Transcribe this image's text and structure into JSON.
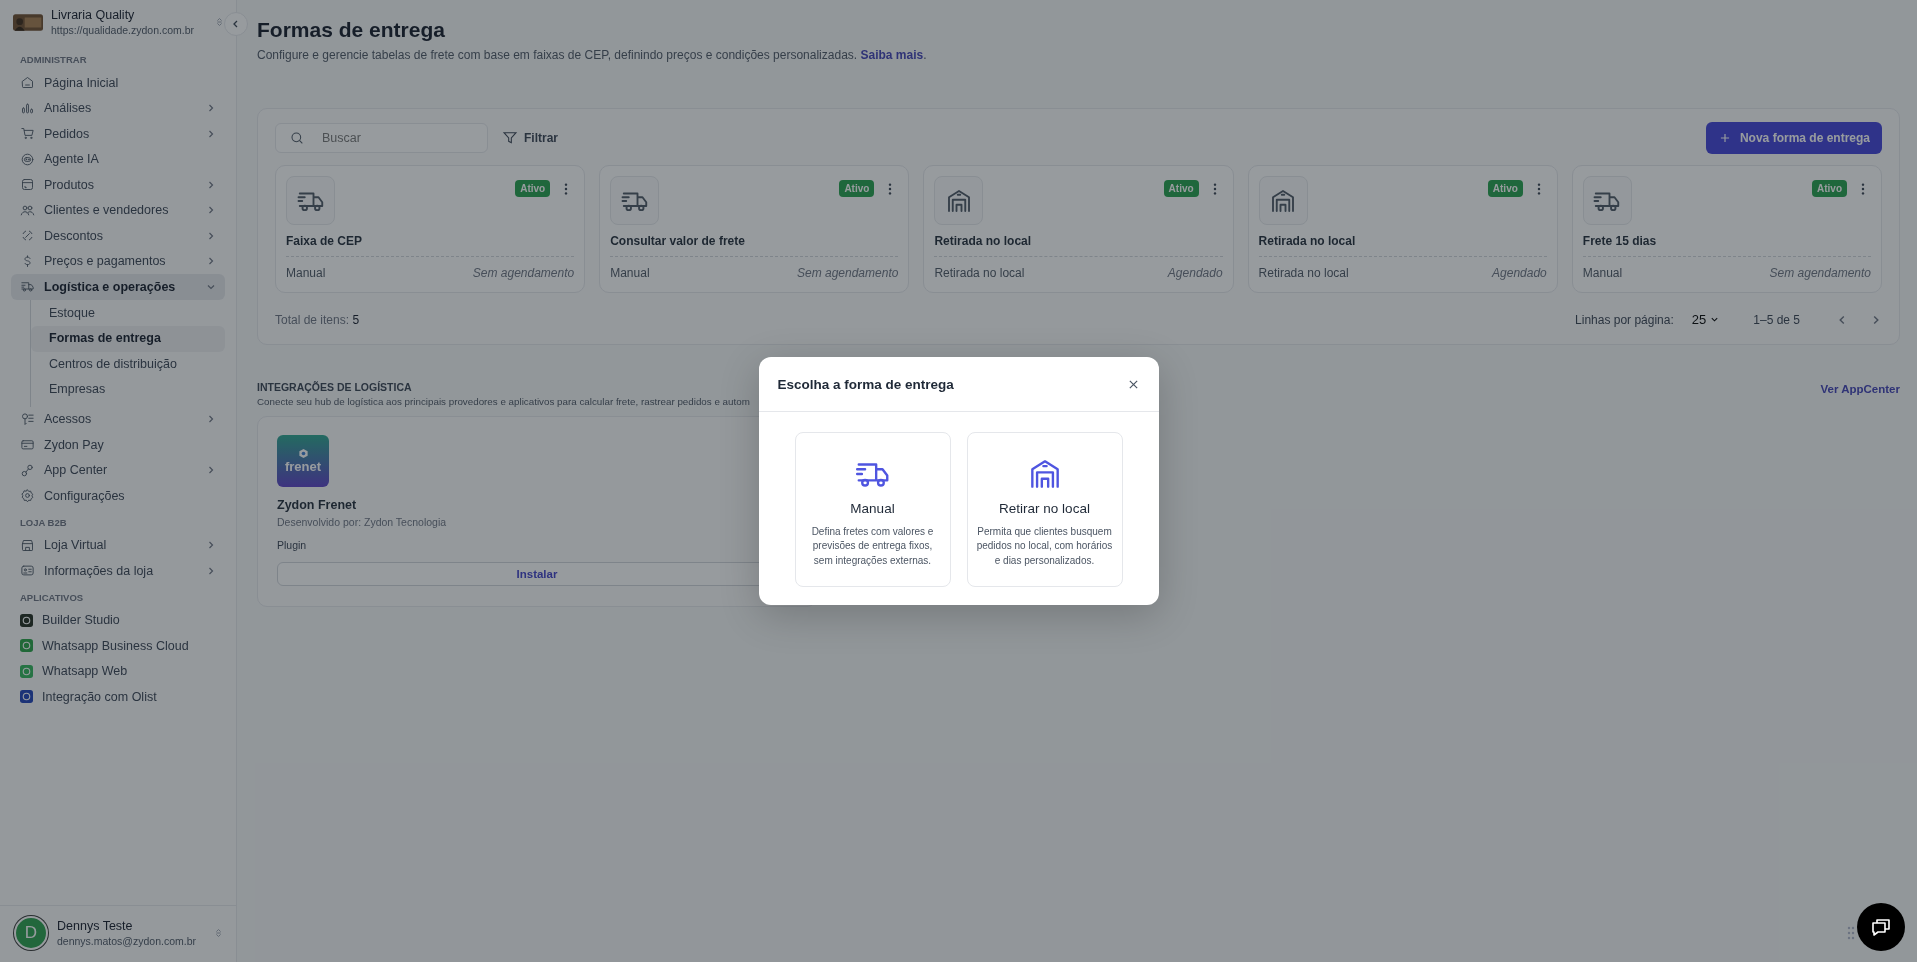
{
  "store": {
    "name": "Livraria Quality",
    "url": "https://qualidade.zydon.com.br"
  },
  "sidebar": [
    {
      "title": "ADMINISTRAR",
      "kind": "nav",
      "items": [
        {
          "label": "Página Inicial",
          "selected": false,
          "expandable": false
        },
        {
          "label": "Análises",
          "selected": false,
          "expandable": true,
          "expanded": false
        },
        {
          "label": "Pedidos",
          "selected": false,
          "expandable": true,
          "expanded": false
        },
        {
          "label": "Agente IA",
          "selected": false,
          "expandable": false
        },
        {
          "label": "Produtos",
          "selected": false,
          "expandable": true,
          "expanded": false
        },
        {
          "label": "Clientes e vendedores",
          "selected": false,
          "expandable": true,
          "expanded": false
        },
        {
          "label": "Descontos",
          "selected": false,
          "expandable": true,
          "expanded": false
        },
        {
          "label": "Preços e pagamentos",
          "selected": false,
          "expandable": true,
          "expanded": false
        },
        {
          "label": "Logística e operações",
          "selected": true,
          "expandable": true,
          "expanded": true,
          "children": [
            {
              "label": "Estoque",
              "selected": false
            },
            {
              "label": "Formas de entrega",
              "selected": true
            },
            {
              "label": "Centros de distribuição",
              "selected": false
            },
            {
              "label": "Empresas",
              "selected": false
            }
          ]
        },
        {
          "label": "Acessos",
          "selected": false,
          "expandable": true,
          "expanded": false
        },
        {
          "label": "Zydon Pay",
          "selected": false,
          "expandable": false
        },
        {
          "label": "App Center",
          "selected": false,
          "expandable": true,
          "expanded": false
        },
        {
          "label": "Configurações",
          "selected": false,
          "expandable": false
        }
      ]
    },
    {
      "title": "LOJA B2B",
      "kind": "nav",
      "items": [
        {
          "label": "Loja Virtual",
          "selected": false,
          "expandable": true,
          "expanded": false
        },
        {
          "label": "Informações da loja",
          "selected": false,
          "expandable": true,
          "expanded": false
        }
      ]
    },
    {
      "title": "APLICATIVOS",
      "kind": "apps",
      "items": [
        {
          "label": "Builder Studio",
          "selected": false
        },
        {
          "label": "Whatsapp Business Cloud",
          "selected": false
        },
        {
          "label": "Whatsapp Web",
          "selected": false
        },
        {
          "label": "Integração com Olist",
          "selected": false
        }
      ]
    }
  ],
  "user": {
    "initial": "D",
    "name": "Dennys Teste",
    "email": "dennys.matos@zydon.com.br"
  },
  "page": {
    "title": "Formas de entrega",
    "subtitle": "Configure e gerencie tabelas de frete com base em faixas de CEP, definindo preços e condições personalizadas.",
    "link": "Saiba mais",
    "link_end": "."
  },
  "toolbar": {
    "search_placeholder": "Buscar",
    "filter": "Filtrar",
    "new_button": "Nova forma de entrega"
  },
  "methods": [
    {
      "kind": "truck",
      "name": "Faixa de CEP",
      "type": "Manual",
      "schedule": "Sem agendamento",
      "status": "Ativo",
      "active": true
    },
    {
      "kind": "truck",
      "name": "Consultar valor de frete",
      "type": "Manual",
      "schedule": "Sem agendamento",
      "status": "Ativo",
      "active": true
    },
    {
      "kind": "warehouse",
      "name": "Retirada no local",
      "type": "Retirada no local",
      "schedule": "Agendado",
      "status": "Ativo",
      "active": true
    },
    {
      "kind": "warehouse",
      "name": "Retirada no local",
      "type": "Retirada no local",
      "schedule": "Agendado",
      "status": "Ativo",
      "active": true
    },
    {
      "kind": "truck",
      "name": "Frete 15 dias",
      "type": "Manual",
      "schedule": "Sem agendamento",
      "status": "Ativo",
      "active": true
    }
  ],
  "list_footer": {
    "total_label": "Total de itens:",
    "total": "5",
    "rows_label": "Linhas por página:",
    "rows": "25",
    "range": "1–5 de 5"
  },
  "integrations": {
    "title": "INTEGRAÇÕES DE LOGÍSTICA",
    "subtitle": "Conecte seu hub de logística aos principais provedores e aplicativos para calcular frete, rastrear pedidos e autom",
    "link": "Ver AppCenter",
    "apps": [
      {
        "logo": "frenet",
        "name": "Zydon Frenet",
        "developer": "Desenvolvido por: Zydon Tecnologia",
        "type": "Plugin",
        "action": "Instalar"
      }
    ]
  },
  "modal": {
    "title": "Escolha a forma de entrega",
    "options": [
      {
        "kind": "truck",
        "title": "Manual",
        "description": "Defina fretes com valores e previsões de entrega fixos, sem integrações externas."
      },
      {
        "kind": "warehouse",
        "title": "Retirar no local",
        "description": "Permita que clientes busquem pedidos no local, com horários e dias personalizados."
      }
    ]
  }
}
